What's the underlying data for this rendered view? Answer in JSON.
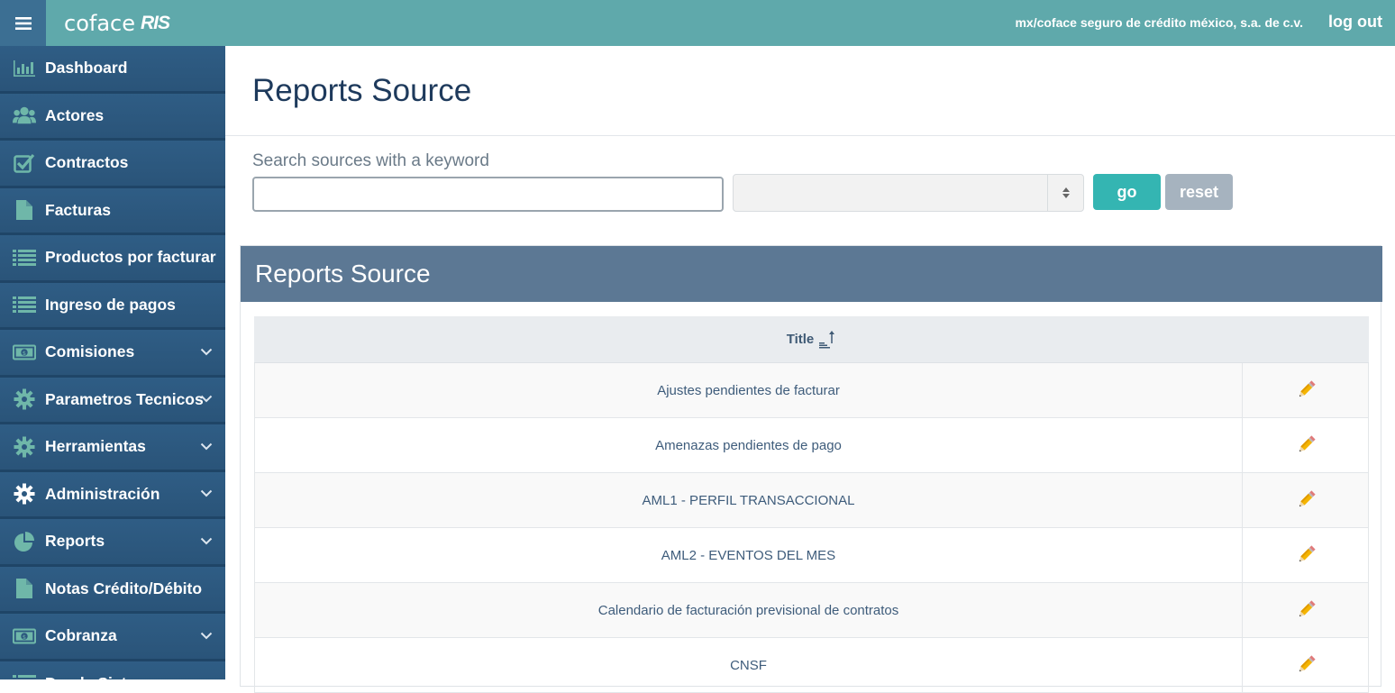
{
  "header": {
    "logo_text": "coface",
    "logo_suffix": "RIS",
    "company": "mx/coface seguro de crédito méxico, s.a. de c.v.",
    "logout": "log out"
  },
  "sidebar": {
    "items": [
      {
        "label": "Dashboard",
        "icon": "bar-chart-icon",
        "expandable": false
      },
      {
        "label": "Actores",
        "icon": "users-icon",
        "expandable": false
      },
      {
        "label": "Contractos",
        "icon": "checkbox-icon",
        "expandable": false
      },
      {
        "label": "Facturas",
        "icon": "file-icon",
        "expandable": false
      },
      {
        "label": "Productos por facturar",
        "icon": "list-icon",
        "expandable": false
      },
      {
        "label": "Ingreso de pagos",
        "icon": "list-icon",
        "expandable": false
      },
      {
        "label": "Comisiones",
        "icon": "money-icon",
        "expandable": true
      },
      {
        "label": "Parametros Tecnicos",
        "icon": "gear-icon",
        "expandable": true
      },
      {
        "label": "Herramientas",
        "icon": "gear-icon",
        "expandable": true
      },
      {
        "label": "Administración",
        "icon": "gear-icon",
        "expandable": true
      },
      {
        "label": "Reports",
        "icon": "pie-chart-icon",
        "expandable": true
      },
      {
        "label": "Notas Crédito/Débito",
        "icon": "file-icon",
        "expandable": false
      },
      {
        "label": "Cobranza",
        "icon": "money-icon",
        "expandable": true
      },
      {
        "label": "Deuda Sist...",
        "icon": "list-icon",
        "expandable": false
      }
    ]
  },
  "main": {
    "title": "Reports Source",
    "search_label": "Search sources with a keyword",
    "search_value": "",
    "select_value": "",
    "go_label": "go",
    "reset_label": "reset",
    "panel_title": "Reports Source",
    "table": {
      "column_title": "Title",
      "rows": [
        "Ajustes pendientes de facturar",
        "Amenazas pendientes de pago",
        "AML1 - PERFIL TRANSACCIONAL",
        "AML2 - EVENTOS DEL MES",
        "Calendario de facturación previsional de contratos",
        "CNSF"
      ]
    }
  },
  "colors": {
    "topbar": "#5fa9ab",
    "sidebar": "#2c587f",
    "accent_go": "#34b5b2",
    "panel_header": "#5c7894",
    "icon_green": "#6fb7a9"
  }
}
